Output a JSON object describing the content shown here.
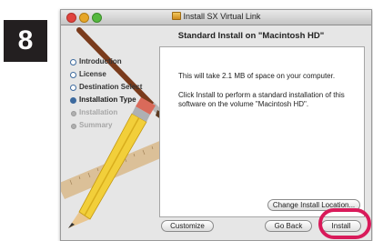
{
  "step_badge": "8",
  "window": {
    "title": "Install SX Virtual Link",
    "subtitle": "Standard Install on \"Macintosh HD\""
  },
  "steps": [
    {
      "label": "Introduction",
      "state": "done"
    },
    {
      "label": "License",
      "state": "done"
    },
    {
      "label": "Destination Select",
      "state": "done"
    },
    {
      "label": "Installation Type",
      "state": "current"
    },
    {
      "label": "Installation",
      "state": "future"
    },
    {
      "label": "Summary",
      "state": "future"
    }
  ],
  "content": {
    "space_message": "This will take 2.1 MB of space on your computer.",
    "install_message": "Click Install to perform a standard installation of this software on the volume \"Macintosh HD\"."
  },
  "buttons": {
    "change_location": "Change Install Location...",
    "customize": "Customize",
    "go_back": "Go Back",
    "install": "Install"
  },
  "colors": {
    "highlight": "#d91a5a",
    "current_step_dot": "#3d6a9e"
  }
}
